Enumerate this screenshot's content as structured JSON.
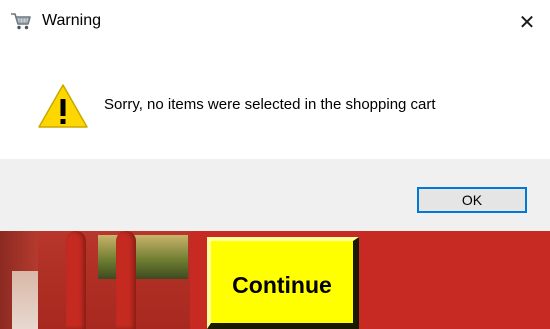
{
  "dialog": {
    "title": "Warning",
    "title_icon": "shopping-cart-icon",
    "close_label": "✕",
    "message": "Sorry, no items were selected in the shopping cart",
    "message_icon": "warning-icon",
    "ok_label": "OK"
  },
  "background_app": {
    "continue_label": "Continue"
  },
  "colors": {
    "warning_yellow": "#ffd700",
    "focus_border": "#0078d7",
    "footer_bg": "#f0f0f0",
    "app_red": "#c62a22",
    "continue_yellow": "#ffff00"
  }
}
